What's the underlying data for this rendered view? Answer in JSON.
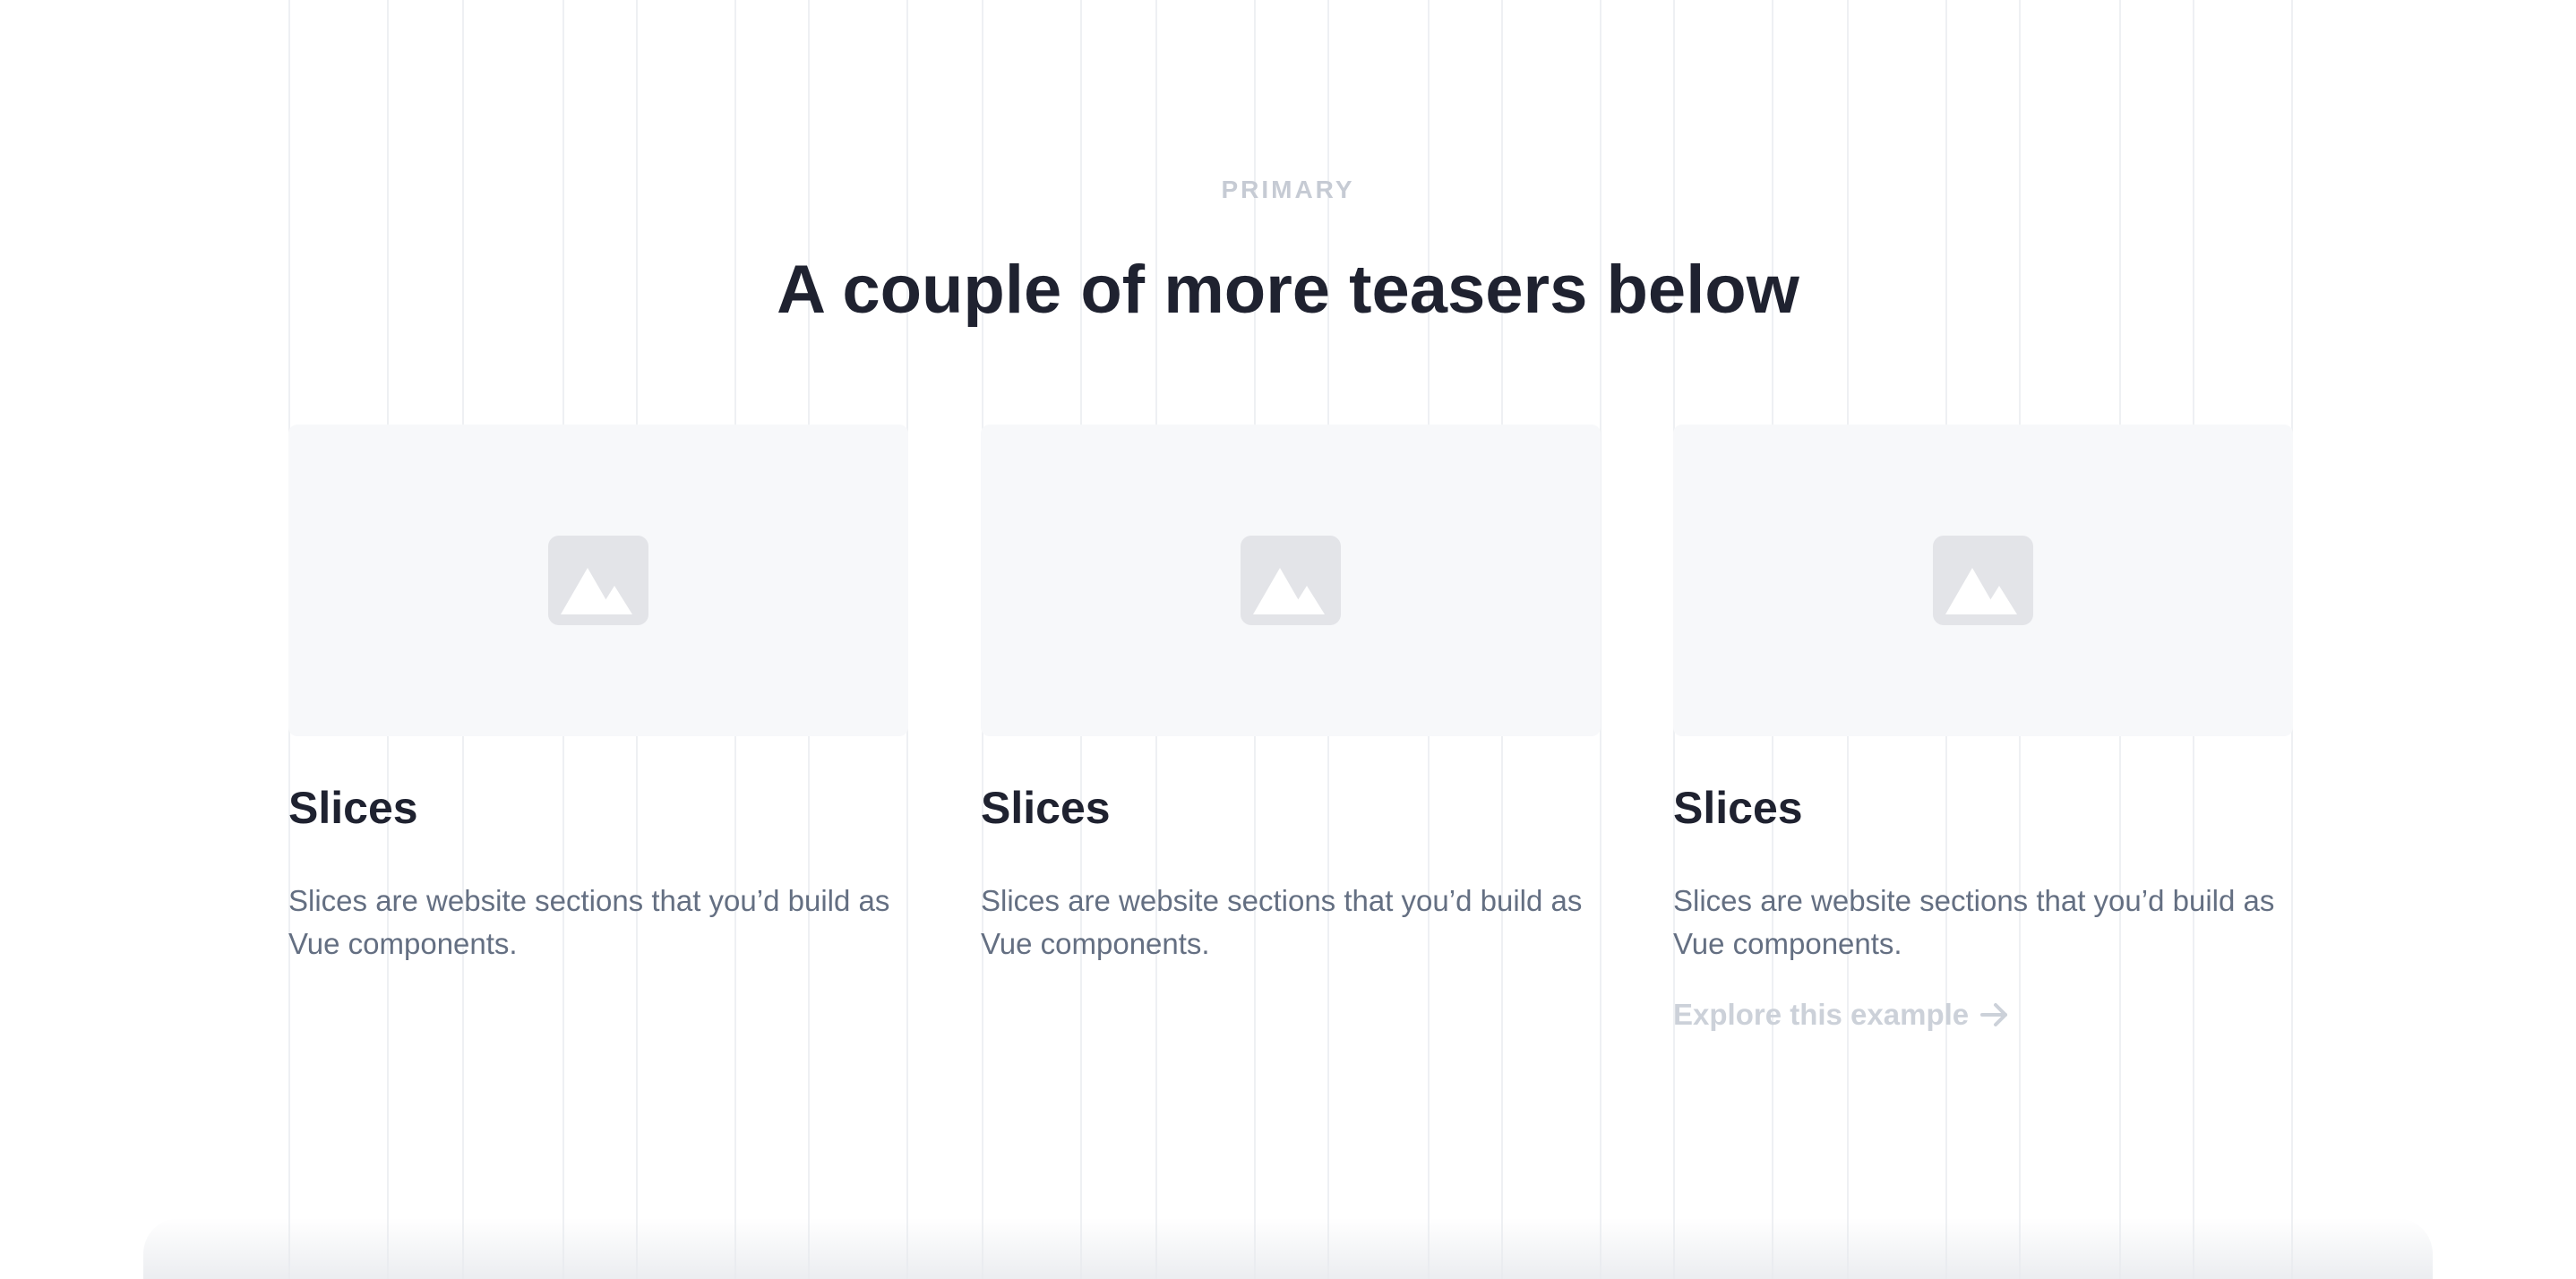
{
  "section": {
    "eyebrow": "PRIMARY",
    "heading": "A couple of more teasers below"
  },
  "cards": [
    {
      "icon": "image-placeholder-icon",
      "title": "Slices",
      "description": "Slices are website sections that you’d build as Vue components."
    },
    {
      "icon": "image-placeholder-icon",
      "title": "Slices",
      "description": "Slices are website sections that you’d build as Vue components."
    },
    {
      "icon": "image-placeholder-icon",
      "title": "Slices",
      "description": "Slices are website sections that you’d build as Vue components.",
      "link_label": "Explore this example",
      "link_icon": "arrow-right-icon"
    }
  ],
  "colors": {
    "heading": "#1f2230",
    "body_text": "#646f82",
    "muted": "#c6cbd4",
    "thumbnail_bg": "#f7f8fa",
    "grid_line": "#eef0f3"
  }
}
